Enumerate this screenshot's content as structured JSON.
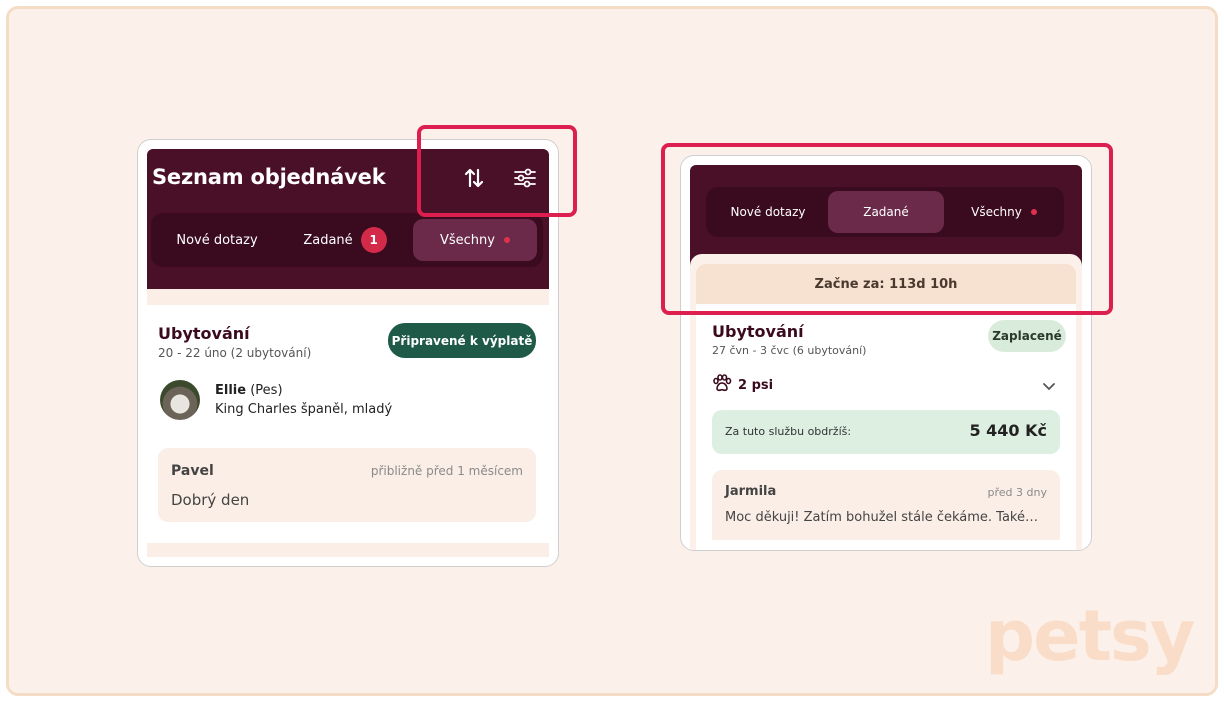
{
  "left_card": {
    "title": "Seznam objednávek",
    "tabs": [
      {
        "label": "Nové dotazy"
      },
      {
        "label": "Zadané",
        "badge": "1"
      },
      {
        "label": "Všechny"
      }
    ],
    "booking": {
      "title": "Ubytování",
      "dates": "20 - 22 úno (2 ubytování)",
      "status": "Připravené k výplatě",
      "pet_name": "Ellie",
      "pet_type": "(Pes)",
      "pet_desc": "King Charles španěl, mladý"
    },
    "message": {
      "author": "Pavel",
      "time": "přibližně před 1 měsícem",
      "text": "Dobrý den"
    }
  },
  "right_card": {
    "tabs": [
      {
        "label": "Nové dotazy"
      },
      {
        "label": "Zadané"
      },
      {
        "label": "Všechny"
      }
    ],
    "starts_in": "Začne za: 113d 10h",
    "booking": {
      "title": "Ubytování",
      "dates": "27 čvn - 3 čvc (6 ubytování)",
      "status": "Zaplacené",
      "pets": "2 psi",
      "earn_label": "Za tuto službu obdržíš:",
      "earn_value": "5 440 Kč"
    },
    "message": {
      "author": "Jarmila",
      "time": "před 3 dny",
      "text": "Moc děkuji! Zatím bohužel stále čekáme. Také…"
    }
  },
  "logo": "petsy",
  "colors": {
    "brand_dark": "#4a1028",
    "highlight": "#dc1f4e",
    "ready": "#1f5a48",
    "paid": "#d9ecdb",
    "background": "#fcf1ea"
  }
}
